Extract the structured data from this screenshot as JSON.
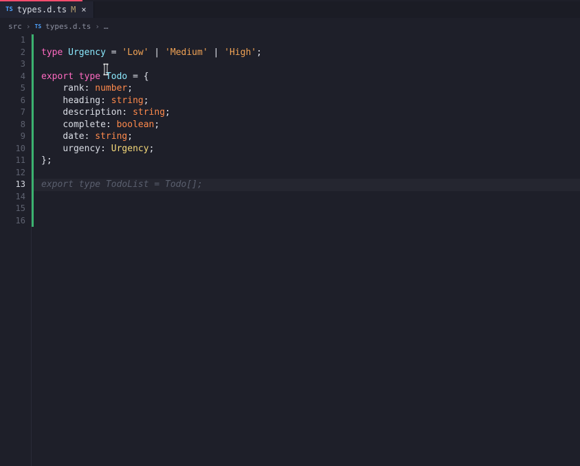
{
  "tab": {
    "language_badge": "TS",
    "filename": "types.d.ts",
    "modified_indicator": "M",
    "close": "×"
  },
  "breadcrumb": {
    "segment1": "src",
    "sep": "›",
    "language_badge": "TS",
    "segment2": "types.d.ts",
    "more": "…"
  },
  "editor": {
    "line_count": 16,
    "current_line": 13,
    "tokens": {
      "l2": {
        "kw_type": "type",
        "name": "Urgency",
        "eq": " = ",
        "s1": "'Low'",
        "bar": " | ",
        "s2": "'Medium'",
        "s3": "'High'",
        "semi": ";"
      },
      "l4": {
        "kw_export": "export",
        "kw_type": "type",
        "name": "Todo",
        "eq": " = ",
        "brace": "{"
      },
      "l5": {
        "prop": "rank",
        "colon": ": ",
        "type": "number",
        "semi": ";"
      },
      "l6": {
        "prop": "heading",
        "colon": ": ",
        "type": "string",
        "semi": ";"
      },
      "l7": {
        "prop": "description",
        "colon": ": ",
        "type": "string",
        "semi": ";"
      },
      "l8": {
        "prop": "complete",
        "colon": ": ",
        "type": "boolean",
        "semi": ";"
      },
      "l9": {
        "prop": "date",
        "colon": ": ",
        "type": "string",
        "semi": ";"
      },
      "l10": {
        "prop": "urgency",
        "colon": ": ",
        "type": "Urgency",
        "semi": ";"
      },
      "l11": {
        "rbrace": "};"
      },
      "l13": {
        "ghost": "export type TodoList = Todo[];"
      }
    }
  }
}
